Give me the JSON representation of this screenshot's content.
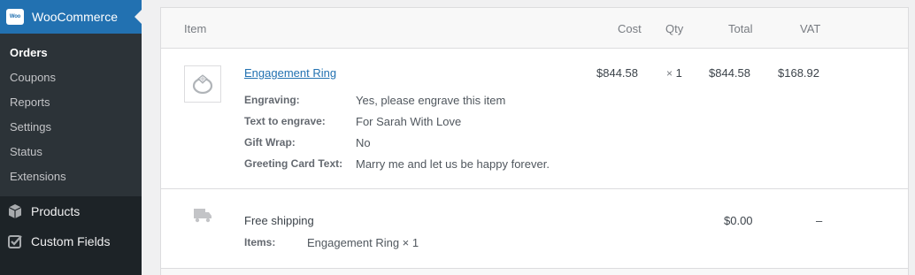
{
  "sidebar": {
    "woo_logo_text": "Woo",
    "woo_label": "WooCommerce",
    "submenu": [
      "Orders",
      "Coupons",
      "Reports",
      "Settings",
      "Status",
      "Extensions"
    ],
    "products_label": "Products",
    "custom_fields_label": "Custom Fields"
  },
  "table": {
    "headers": {
      "item": "Item",
      "cost": "Cost",
      "qty": "Qty",
      "total": "Total",
      "vat": "VAT"
    },
    "line_item": {
      "name": "Engagement Ring",
      "cost": "$844.58",
      "qty_x": "×",
      "qty": "1",
      "total": "$844.58",
      "vat": "$168.92",
      "meta": [
        {
          "label": "Engraving:",
          "value": "Yes, please engrave this item"
        },
        {
          "label": "Text to engrave:",
          "value": "For Sarah With Love"
        },
        {
          "label": "Gift Wrap:",
          "value": "No"
        },
        {
          "label": "Greeting Card Text:",
          "value": "Marry me and let us be happy forever."
        }
      ]
    },
    "shipping": {
      "name": "Free shipping",
      "items_label": "Items:",
      "items_value": "Engagement Ring × 1",
      "total": "$0.00",
      "vat": "–"
    }
  }
}
